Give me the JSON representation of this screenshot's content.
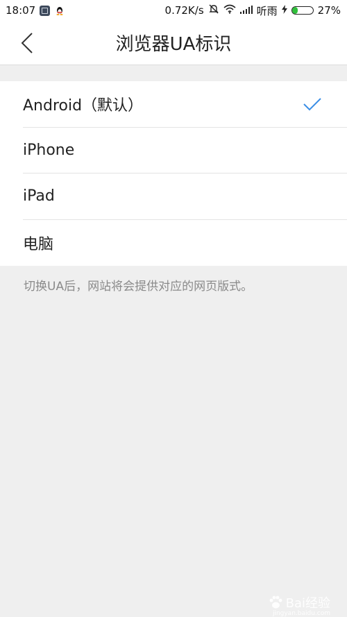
{
  "status_bar": {
    "time": "18:07",
    "net_speed": "0.72K/s",
    "carrier": "听雨",
    "battery_percent": "27%",
    "battery_level": 0.27,
    "battery_color": "#2fbf3a"
  },
  "header": {
    "title": "浏览器UA标识"
  },
  "ua_options": [
    {
      "label": "Android（默认）",
      "selected": true
    },
    {
      "label": "iPhone",
      "selected": false
    },
    {
      "label": "iPad",
      "selected": false
    },
    {
      "label": "电脑",
      "selected": false
    }
  ],
  "hint_text": "切换UA后，网站将会提供对应的网页版式。",
  "watermark": {
    "text": "Bai经验",
    "sub": "jingyan.baidu.com"
  },
  "colors": {
    "check": "#3a8ee6",
    "page_bg": "#efefef"
  }
}
